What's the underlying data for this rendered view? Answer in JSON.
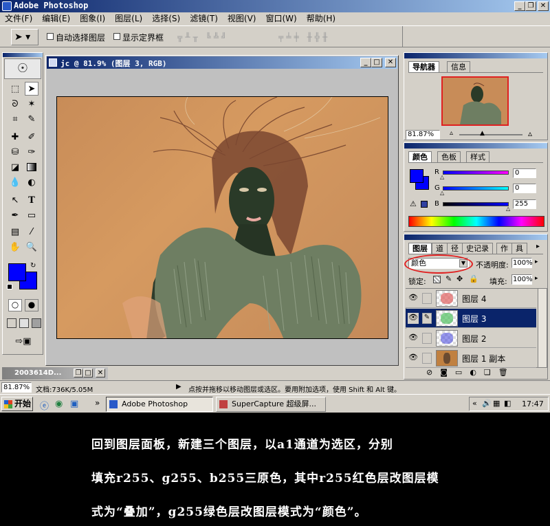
{
  "app": {
    "title": "Adobe Photoshop"
  },
  "menu": [
    "文件(F)",
    "编辑(E)",
    "图象(I)",
    "图层(L)",
    "选择(S)",
    "滤镜(T)",
    "视图(V)",
    "窗口(W)",
    "帮助(H)"
  ],
  "options": {
    "auto_select": "自动选择图层",
    "show_bounds": "显示定界框"
  },
  "doc": {
    "title": "jc @ 81.9% (图层 3, RGB)"
  },
  "minimized": {
    "label": "2003614D..."
  },
  "navigator": {
    "tabs": [
      "导航器",
      "信息"
    ],
    "zoom": "81.87%"
  },
  "color": {
    "tabs": [
      "颜色",
      "色板",
      "样式"
    ],
    "r_label": "R",
    "g_label": "G",
    "b_label": "B",
    "r": "0",
    "g": "0",
    "b": "255",
    "fg": "#0000ff"
  },
  "layers": {
    "tabs": [
      "图层",
      "道",
      "径",
      "史记录",
      "作",
      "具"
    ],
    "blend_mode": "颜色",
    "opacity_label": "不透明度:",
    "opacity": "100%",
    "lock_label": "锁定:",
    "fill_label": "填充:",
    "fill": "100%",
    "items": [
      {
        "name": "图层 4",
        "color": "#e06060"
      },
      {
        "name": "图层 3",
        "color": "#50c060"
      },
      {
        "name": "图层 2",
        "color": "#5050e0"
      },
      {
        "name": "图层 1 副本",
        "color": "#c08040"
      }
    ]
  },
  "status": {
    "zoom": "81.87%",
    "doc": "文档:736K/5.05M",
    "hint": "点按并拖移以移动图层或选区。要用附加选项，使用 Shift 和 Alt 键。"
  },
  "taskbar": {
    "start": "开始",
    "tasks": [
      "Adobe Photoshop",
      "SuperCapture 超级屏..."
    ],
    "clock": "17:47"
  },
  "caption": {
    "line1": "回到图层面板，新建三个图层，以a1通道为选区，分别",
    "line2": "填充r255、g255、b255三原色，其中r255红色层改图层模",
    "line3": "式为“叠加”，g255绿色层改图层模式为“颜色”。"
  }
}
